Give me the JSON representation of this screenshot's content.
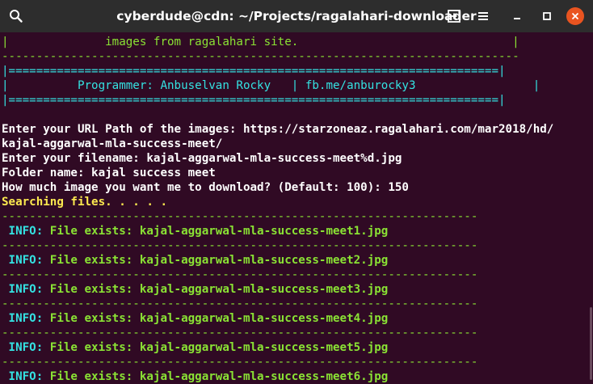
{
  "window": {
    "title": "cyberdude@cdn: ~/Projects/ragalahari-downloader"
  },
  "colors": {
    "background": "#300a24",
    "titlebar": "#2d2d2d",
    "green": "#8ae234",
    "cyan": "#34e2e2",
    "yellow": "#fce94f",
    "close": "#e95420"
  },
  "icons": {
    "search": "search-icon",
    "new_tab": "new-tab-icon",
    "menu": "hamburger-menu-icon",
    "minimize": "minimize-icon",
    "maximize": "maximize-icon",
    "close": "close-icon"
  },
  "terminal": {
    "banner": {
      "line1": "|              images from ragalahari site.                               |",
      "line2": "---------------------------------------------------------------------------",
      "line3": "|=======================================================================|",
      "line4": "|          Programmer: Anbuselvan Rocky   | fb.me/anburocky3                 |",
      "line5": "|=======================================================================|"
    },
    "prompts": {
      "url_label": "Enter your URL Path of the images: ",
      "url_value_1": "https://starzoneaz.ragalahari.com/mar2018/hd/",
      "url_value_2": "kajal-aggarwal-mla-success-meet/",
      "filename_label": "Enter your filename: ",
      "filename_value": "kajal-aggarwal-mla-success-meet%d.jpg",
      "folder_label": "Folder name: ",
      "folder_value": "kajal success meet",
      "count_label": "How much image you want me to download? (Default: 100): ",
      "count_value": "150",
      "searching": "Searching files. . . . ."
    },
    "separator": "---------------------------------------------------------------------",
    "info_tag": " INFO:",
    "info_entries": [
      " File exists: kajal-aggarwal-mla-success-meet1.jpg",
      " File exists: kajal-aggarwal-mla-success-meet2.jpg",
      " File exists: kajal-aggarwal-mla-success-meet3.jpg",
      " File exists: kajal-aggarwal-mla-success-meet4.jpg",
      " File exists: kajal-aggarwal-mla-success-meet5.jpg",
      " File exists: kajal-aggarwal-mla-success-meet6.jpg"
    ]
  }
}
